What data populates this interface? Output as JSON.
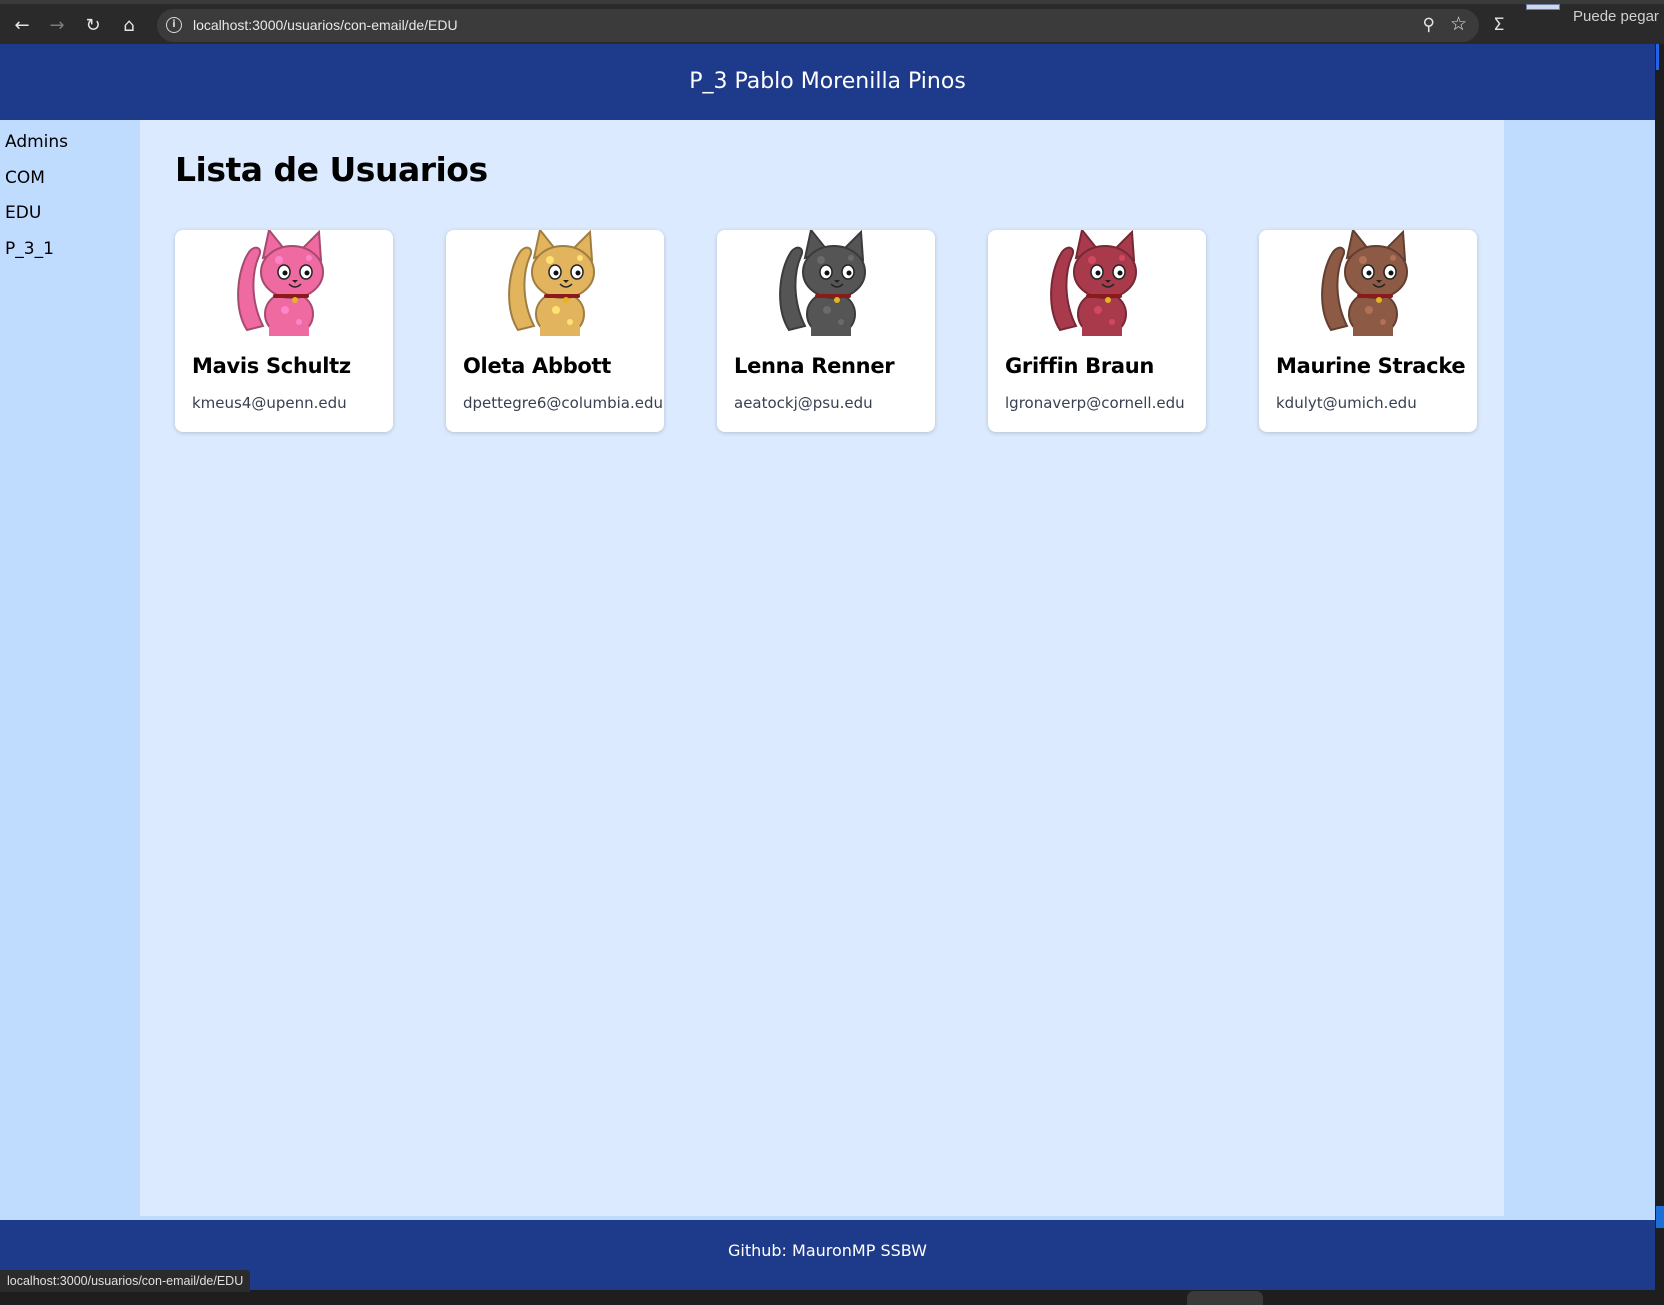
{
  "browser": {
    "url": "localhost:3000/usuarios/con-email/de/EDU",
    "status_url": "localhost:3000/usuarios/con-email/de/EDU",
    "peek_text": "Puede pegar l"
  },
  "header": {
    "title": "P_3 Pablo Morenilla Pinos"
  },
  "sidebar": {
    "items": [
      {
        "label": "Admins"
      },
      {
        "label": "COM"
      },
      {
        "label": "EDU"
      },
      {
        "label": "P_3_1"
      }
    ]
  },
  "main": {
    "title": "Lista de Usuarios"
  },
  "users": [
    {
      "name": "Mavis Schultz",
      "email": "kmeus4@upenn.edu",
      "avatar_color": "#ee6aa0"
    },
    {
      "name": "Oleta Abbott",
      "email": "dpettegre6@columbia.edu",
      "avatar_color": "#e2b45d"
    },
    {
      "name": "Lenna Renner",
      "email": "aeatockj@psu.edu",
      "avatar_color": "#555555"
    },
    {
      "name": "Griffin Braun",
      "email": "lgronaverp@cornell.edu",
      "avatar_color": "#a83a4c"
    },
    {
      "name": "Maurine Stracke",
      "email": "kdulyt@umich.edu",
      "avatar_color": "#8d5a45"
    }
  ],
  "footer": {
    "text": "Github: MauronMP SSBW"
  },
  "colors": {
    "header_bg": "#1e3a8a",
    "sidebar_bg": "#bfdbfe",
    "main_bg": "#dbeafe"
  }
}
